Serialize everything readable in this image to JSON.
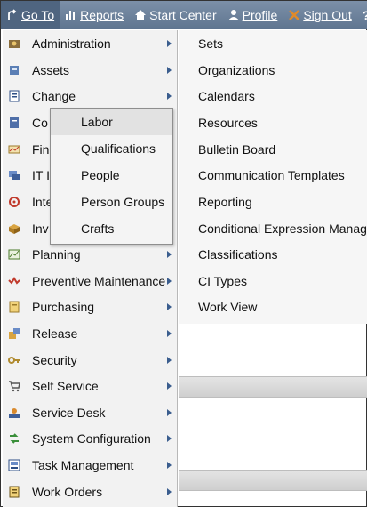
{
  "topbar": {
    "goto": "Go To",
    "reports": "Reports",
    "start_center": "Start Center",
    "profile": "Profile",
    "sign_out": "Sign Out",
    "help": "?"
  },
  "menu": {
    "items": [
      {
        "label": "Administration"
      },
      {
        "label": "Assets"
      },
      {
        "label": "Change"
      },
      {
        "label": "Co"
      },
      {
        "label": "Fin"
      },
      {
        "label": "IT I"
      },
      {
        "label": "Inte"
      },
      {
        "label": "Inv"
      },
      {
        "label": "Planning"
      },
      {
        "label": "Preventive Maintenance"
      },
      {
        "label": "Purchasing"
      },
      {
        "label": "Release"
      },
      {
        "label": "Security"
      },
      {
        "label": "Self Service"
      },
      {
        "label": "Service Desk"
      },
      {
        "label": "System Configuration"
      },
      {
        "label": "Task Management"
      },
      {
        "label": "Work Orders"
      }
    ]
  },
  "submenu": {
    "items": [
      {
        "label": "Sets"
      },
      {
        "label": "Organizations"
      },
      {
        "label": "Calendars"
      },
      {
        "label": "Resources"
      },
      {
        "label": "Bulletin Board"
      },
      {
        "label": "Communication Templates"
      },
      {
        "label": "Reporting"
      },
      {
        "label": "Conditional Expression Manager"
      },
      {
        "label": "Classifications"
      },
      {
        "label": "CI Types"
      },
      {
        "label": "Work View"
      }
    ]
  },
  "popup": {
    "items": [
      {
        "label": "Labor"
      },
      {
        "label": "Qualifications"
      },
      {
        "label": "People"
      },
      {
        "label": "Person Groups"
      },
      {
        "label": "Crafts"
      }
    ]
  },
  "colors": {
    "topbar": "#6b8099",
    "menu_bg": "#f2f2f2",
    "arrow": "#3a5d8e"
  }
}
